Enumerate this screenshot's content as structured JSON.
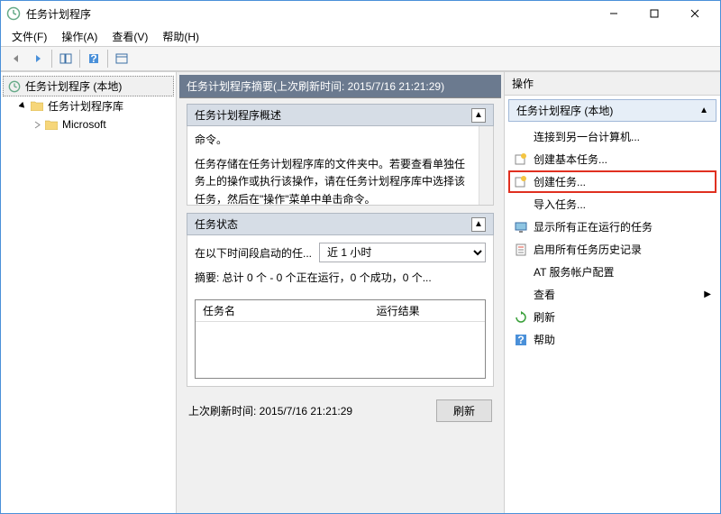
{
  "window": {
    "title": "任务计划程序"
  },
  "menubar": {
    "file": "文件(F)",
    "action": "操作(A)",
    "view": "查看(V)",
    "help": "帮助(H)"
  },
  "tree": {
    "root": "任务计划程序 (本地)",
    "library": "任务计划程序库",
    "microsoft": "Microsoft"
  },
  "center": {
    "header": "任务计划程序摘要(上次刷新时间: 2015/7/16 21:21:29)",
    "overview_title": "任务计划程序概述",
    "overview_line1": "命令。",
    "overview_text": "任务存储在任务计划程序库的文件夹中。若要查看单独任务上的操作或执行该操作，请在任务计划程序库中选择该任务，然后在\"操作\"菜单中单击命令。",
    "status_title": "任务状态",
    "period_label": "在以下时间段启动的任...",
    "period_value": "近 1 小时",
    "summary": "摘要: 总计 0 个 - 0 个正在运行，0 个成功，0 个...",
    "col_name": "任务名",
    "col_result": "运行结果",
    "last_refresh": "上次刷新时间: 2015/7/16 21:21:29",
    "refresh_btn": "刷新"
  },
  "actions": {
    "header": "操作",
    "subheader": "任务计划程序 (本地)",
    "connect": "连接到另一台计算机...",
    "create_basic": "创建基本任务...",
    "create_task": "创建任务...",
    "import": "导入任务...",
    "show_running": "显示所有正在运行的任务",
    "enable_history": "启用所有任务历史记录",
    "at_config": "AT 服务帐户配置",
    "view": "查看",
    "refresh": "刷新",
    "help": "帮助"
  }
}
